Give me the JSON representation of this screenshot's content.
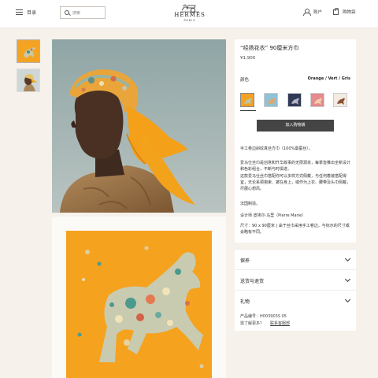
{
  "header": {
    "menu_label": "目录",
    "search_placeholder": "搜索",
    "brand": "HERMES",
    "brand_city": "PARIS",
    "account_label": "账户",
    "cart_label": "购物袋"
  },
  "product": {
    "title": "“经扬花衣” 90厘米方巾",
    "price": "¥1,900",
    "color_label": "颜色",
    "color_value": "Orange / Vert / Gris",
    "swatches": [
      "orange-horse",
      "light-blue",
      "navy",
      "pink",
      "cream-brown"
    ],
    "add_to_cart": "加入购物袋",
    "description": [
      "手工卷边斜纹真丝方巾（100%桑蚕丝）。",
      "爱马仕丝巾是创意和升华故事的无限源泉，每季皆推出全新设计和色彩组合，不断与时俱进。",
      "这款爱马仕丝巾搭配你可以多样方式佩戴，与任何着装搭配得宜，无论系颈抱束、披在身上，或作为上衣、腰带及头巾佩戴，尽展心想风。",
      "法国制造。",
      "设计师 皮埃尔·马里（Pierre Marie）",
      "尺寸：90 x 90厘米 | 由于丝巾采用手工卷边，与标示的尺寸或会略有不同。"
    ]
  },
  "accordions": {
    "care": "保养",
    "shipping": "送货与退货",
    "gift": "礼物"
  },
  "meta": {
    "ref": "产品编号：H003903S 05",
    "help_prefix": "需了解更多？",
    "help_link": "联系客服部"
  },
  "colors": {
    "background": "#f6f1eb",
    "panel": "#ffffff",
    "button": "#444444",
    "scarf_orange": "#f5a623"
  }
}
